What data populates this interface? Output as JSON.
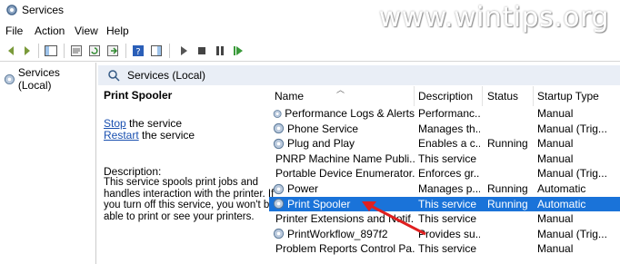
{
  "window": {
    "title": "Services",
    "watermark": "www.wintips.org"
  },
  "menu": [
    "File",
    "Action",
    "View",
    "Help"
  ],
  "tree": {
    "root_label": "Services (Local)"
  },
  "panel": {
    "header_title": "Services (Local)"
  },
  "detail": {
    "service_name": "Print Spooler",
    "stop_link": "Stop",
    "stop_rest": " the service",
    "restart_link": "Restart",
    "restart_rest": " the service",
    "description_label": "Description:",
    "description_text": "This service spools print jobs and handles interaction with the printer. If you turn off this service, you won't be able to print or see your printers."
  },
  "columns": {
    "name": "Name",
    "description": "Description",
    "status": "Status",
    "startup": "Startup Type"
  },
  "rows": [
    {
      "name": "Performance Logs & Alerts",
      "description": "Performanc...",
      "status": "",
      "startup": "Manual"
    },
    {
      "name": "Phone Service",
      "description": "Manages th...",
      "status": "",
      "startup": "Manual (Trig..."
    },
    {
      "name": "Plug and Play",
      "description": "Enables a c...",
      "status": "Running",
      "startup": "Manual"
    },
    {
      "name": "PNRP Machine Name Publi...",
      "description": "This service ...",
      "status": "",
      "startup": "Manual"
    },
    {
      "name": "Portable Device Enumerator...",
      "description": "Enforces gr...",
      "status": "",
      "startup": "Manual (Trig..."
    },
    {
      "name": "Power",
      "description": "Manages p...",
      "status": "Running",
      "startup": "Automatic"
    },
    {
      "name": "Print Spooler",
      "description": "This service ...",
      "status": "Running",
      "startup": "Automatic",
      "selected": true
    },
    {
      "name": "Printer Extensions and Notif...",
      "description": "This service ...",
      "status": "",
      "startup": "Manual"
    },
    {
      "name": "PrintWorkflow_897f2",
      "description": "Provides su...",
      "status": "",
      "startup": "Manual (Trig..."
    },
    {
      "name": "Problem Reports Control Pa...",
      "description": "This service ...",
      "status": "",
      "startup": "Manual"
    }
  ],
  "toolbar_icons": [
    "back-icon",
    "forward-icon",
    "show-hide-tree-icon",
    "properties-icon",
    "refresh-icon",
    "export-list-icon",
    "help-icon",
    "view-icon",
    "start-service-icon",
    "stop-service-icon",
    "pause-service-icon",
    "restart-service-icon"
  ],
  "colors": {
    "selection": "#1a73d9",
    "header_strip": "#e9eef6",
    "link": "#1a50b0",
    "arrow": "#e02020"
  }
}
